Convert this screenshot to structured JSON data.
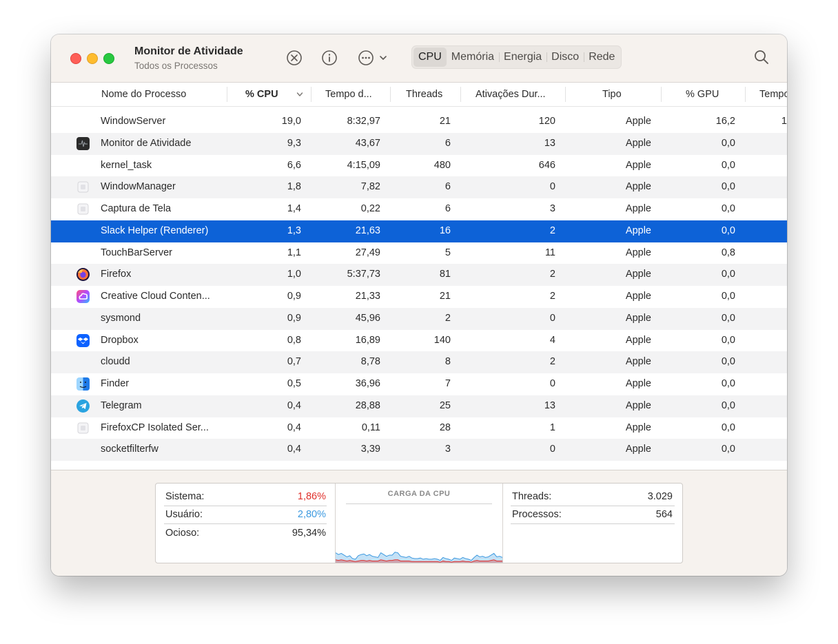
{
  "window": {
    "title": "Monitor de Atividade",
    "subtitle": "Todos os Processos"
  },
  "toolbar": {
    "stop_icon": "stop-process-icon",
    "info_icon": "info-icon",
    "more_icon": "more-options-icon",
    "tabs": [
      "CPU",
      "Memória",
      "Energia",
      "Disco",
      "Rede"
    ],
    "active_tab": "CPU",
    "search_icon": "search-icon"
  },
  "table": {
    "columns": [
      "Nome do Processo",
      "% CPU",
      "Tempo d...",
      "Threads",
      "Ativações Dur...",
      "Tipo",
      "% GPU",
      "Tempo"
    ],
    "sorted_column": "% CPU",
    "rows": [
      {
        "name": "WindowServer",
        "cpu": "19,0",
        "time": "8:32,97",
        "threads": "21",
        "wakeups": "120",
        "kind": "Apple",
        "gpu": "16,2",
        "gtime": "1",
        "icon": "none"
      },
      {
        "name": "Monitor de Atividade",
        "cpu": "9,3",
        "time": "43,67",
        "threads": "6",
        "wakeups": "13",
        "kind": "Apple",
        "gpu": "0,0",
        "gtime": "",
        "icon": "activity-monitor"
      },
      {
        "name": "kernel_task",
        "cpu": "6,6",
        "time": "4:15,09",
        "threads": "480",
        "wakeups": "646",
        "kind": "Apple",
        "gpu": "0,0",
        "gtime": "",
        "icon": "none"
      },
      {
        "name": "WindowManager",
        "cpu": "1,8",
        "time": "7,82",
        "threads": "6",
        "wakeups": "0",
        "kind": "Apple",
        "gpu": "0,0",
        "gtime": "",
        "icon": "generic"
      },
      {
        "name": "Captura de Tela",
        "cpu": "1,4",
        "time": "0,22",
        "threads": "6",
        "wakeups": "3",
        "kind": "Apple",
        "gpu": "0,0",
        "gtime": "",
        "icon": "generic"
      },
      {
        "name": "Slack Helper (Renderer)",
        "cpu": "1,3",
        "time": "21,63",
        "threads": "16",
        "wakeups": "2",
        "kind": "Apple",
        "gpu": "0,0",
        "gtime": "",
        "icon": "none"
      },
      {
        "name": "TouchBarServer",
        "cpu": "1,1",
        "time": "27,49",
        "threads": "5",
        "wakeups": "11",
        "kind": "Apple",
        "gpu": "0,8",
        "gtime": "",
        "icon": "none"
      },
      {
        "name": "Firefox",
        "cpu": "1,0",
        "time": "5:37,73",
        "threads": "81",
        "wakeups": "2",
        "kind": "Apple",
        "gpu": "0,0",
        "gtime": "",
        "icon": "firefox"
      },
      {
        "name": "Creative Cloud Conten...",
        "cpu": "0,9",
        "time": "21,33",
        "threads": "21",
        "wakeups": "2",
        "kind": "Apple",
        "gpu": "0,0",
        "gtime": "",
        "icon": "creative-cloud"
      },
      {
        "name": "sysmond",
        "cpu": "0,9",
        "time": "45,96",
        "threads": "2",
        "wakeups": "0",
        "kind": "Apple",
        "gpu": "0,0",
        "gtime": "",
        "icon": "none"
      },
      {
        "name": "Dropbox",
        "cpu": "0,8",
        "time": "16,89",
        "threads": "140",
        "wakeups": "4",
        "kind": "Apple",
        "gpu": "0,0",
        "gtime": "",
        "icon": "dropbox"
      },
      {
        "name": "cloudd",
        "cpu": "0,7",
        "time": "8,78",
        "threads": "8",
        "wakeups": "2",
        "kind": "Apple",
        "gpu": "0,0",
        "gtime": "",
        "icon": "none"
      },
      {
        "name": "Finder",
        "cpu": "0,5",
        "time": "36,96",
        "threads": "7",
        "wakeups": "0",
        "kind": "Apple",
        "gpu": "0,0",
        "gtime": "",
        "icon": "finder"
      },
      {
        "name": "Telegram",
        "cpu": "0,4",
        "time": "28,88",
        "threads": "25",
        "wakeups": "13",
        "kind": "Apple",
        "gpu": "0,0",
        "gtime": "",
        "icon": "telegram"
      },
      {
        "name": "FirefoxCP Isolated Ser...",
        "cpu": "0,4",
        "time": "0,11",
        "threads": "28",
        "wakeups": "1",
        "kind": "Apple",
        "gpu": "0,0",
        "gtime": "",
        "icon": "generic"
      },
      {
        "name": "socketfilterfw",
        "cpu": "0,4",
        "time": "3,39",
        "threads": "3",
        "wakeups": "0",
        "kind": "Apple",
        "gpu": "0,0",
        "gtime": "",
        "icon": "none"
      }
    ],
    "selected_row": 5
  },
  "summary": {
    "system_label": "Sistema:",
    "system_value": "1,86%",
    "system_color": "#e0302b",
    "user_label": "Usuário:",
    "user_value": "2,80%",
    "user_color": "#3d9ae0",
    "idle_label": "Ocioso:",
    "idle_value": "95,34%",
    "chart_title": "CARGA DA CPU",
    "threads_label": "Threads:",
    "threads_value": "3.029",
    "processes_label": "Processos:",
    "processes_value": "564"
  },
  "cpu_load_history": {
    "user": [
      12,
      10,
      11,
      9,
      7,
      8,
      4,
      4,
      9,
      10,
      11,
      9,
      10,
      8,
      7,
      6,
      12,
      10,
      8,
      9,
      9,
      13,
      12,
      8,
      7,
      6,
      8,
      6,
      5,
      5,
      6,
      4,
      5,
      4,
      4,
      5,
      4,
      3,
      6,
      5,
      4,
      3,
      6,
      5,
      4,
      6,
      5,
      4,
      3,
      6,
      9,
      7,
      8,
      6,
      7,
      9,
      11,
      7,
      8,
      6
    ],
    "system": [
      5,
      4,
      5,
      4,
      3,
      4,
      3,
      2,
      3,
      4,
      4,
      3,
      4,
      3,
      3,
      3,
      5,
      4,
      3,
      4,
      4,
      5,
      5,
      3,
      3,
      3,
      3,
      2,
      2,
      2,
      2,
      2,
      2,
      2,
      2,
      2,
      2,
      1,
      3,
      2,
      2,
      1,
      2,
      2,
      2,
      3,
      2,
      2,
      1,
      3,
      4,
      3,
      3,
      3,
      3,
      4,
      5,
      3,
      3,
      3
    ]
  }
}
